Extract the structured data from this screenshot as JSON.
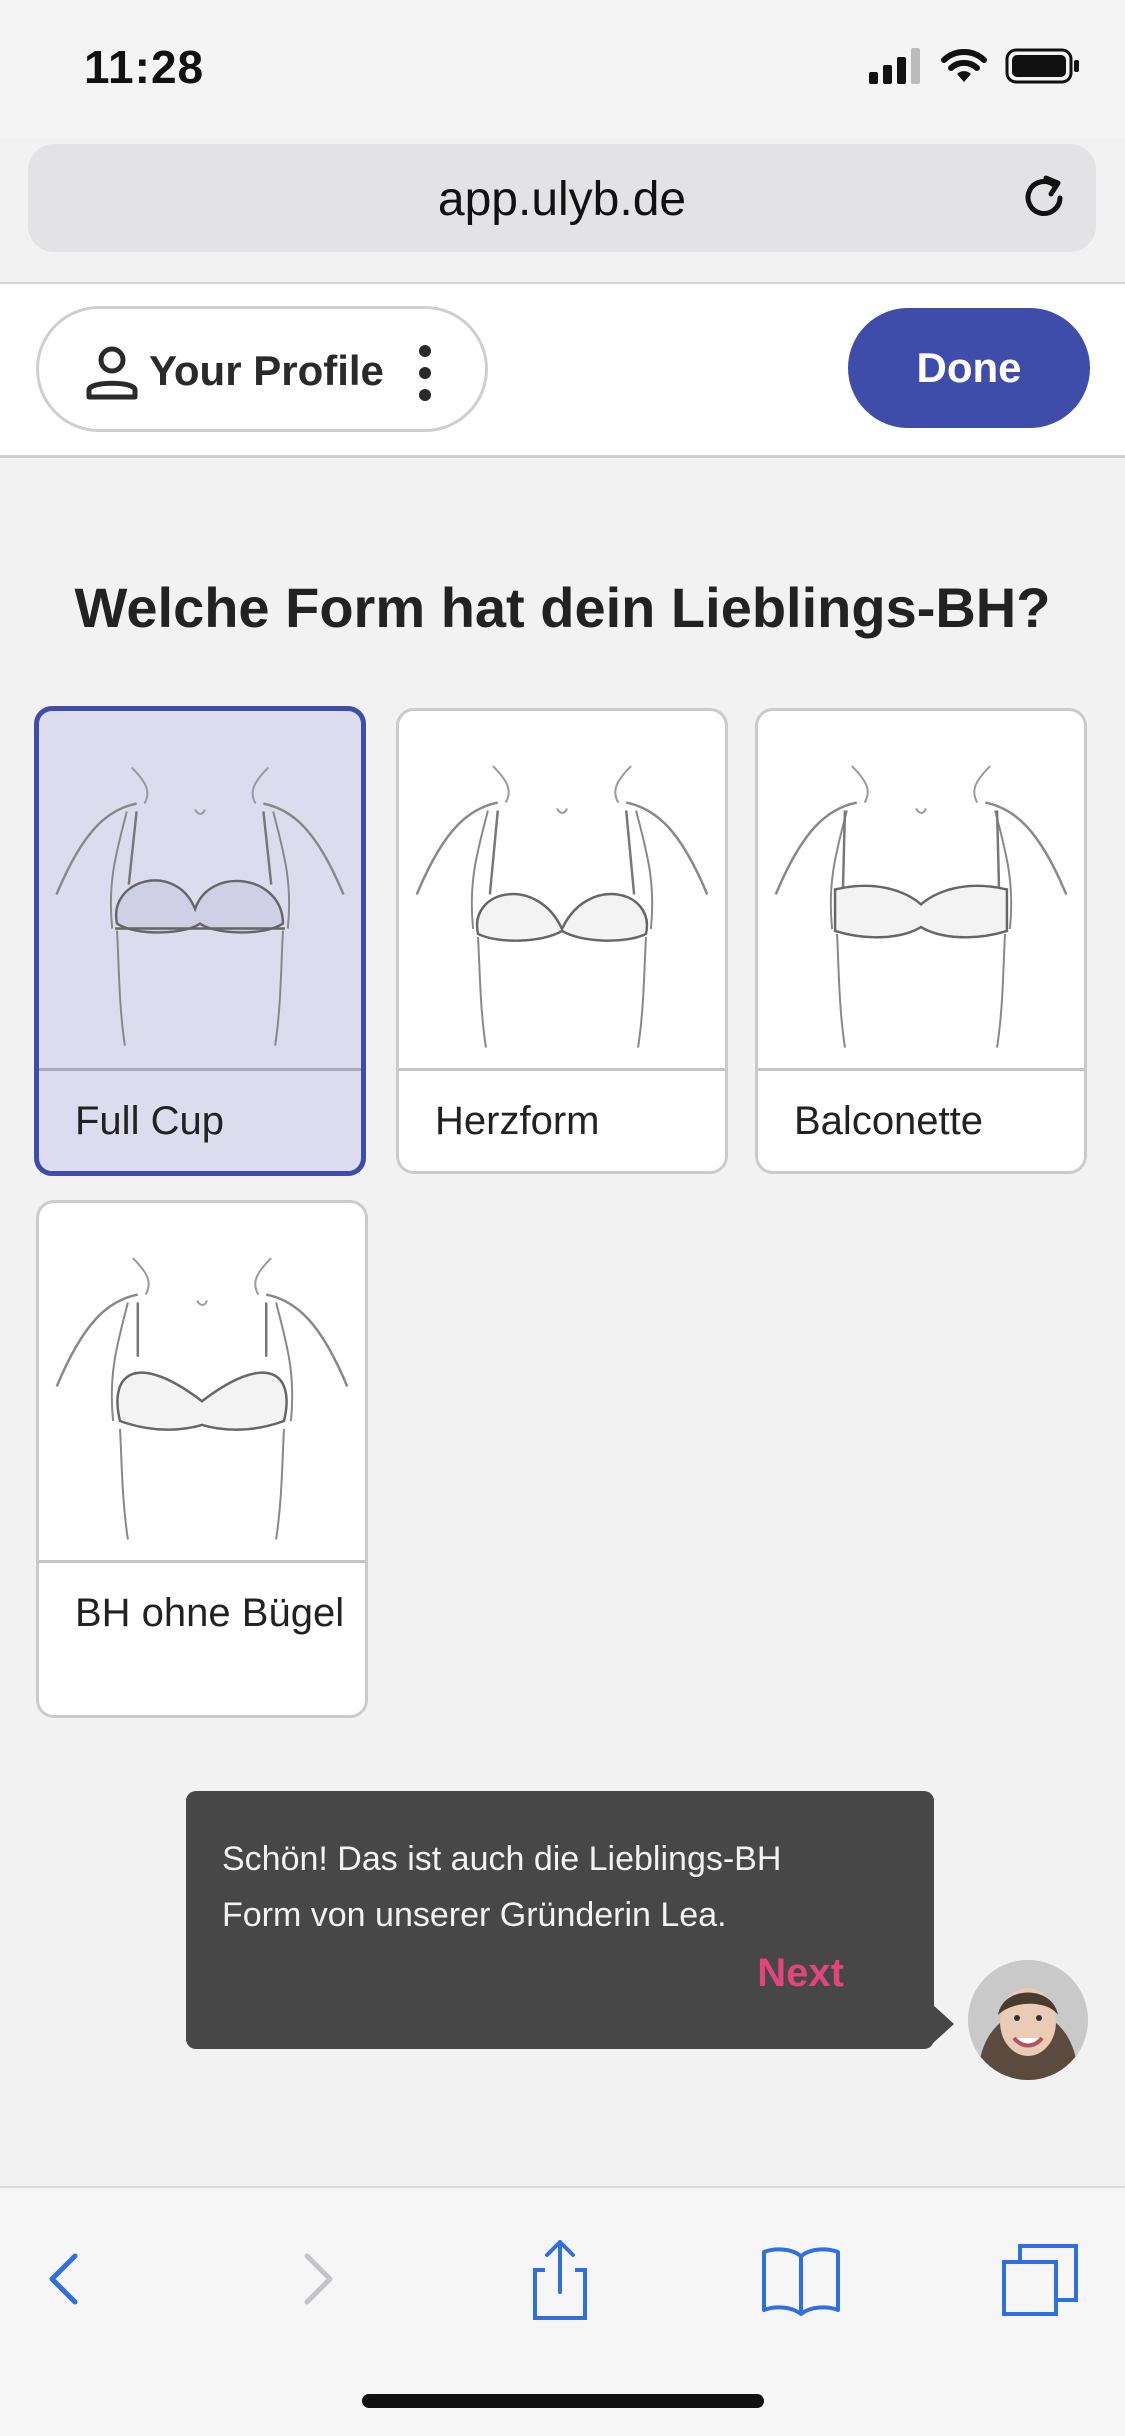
{
  "status_bar": {
    "time": "11:28"
  },
  "browser": {
    "url": "app.ulyb.de"
  },
  "header": {
    "profile_label": "Your Profile",
    "done_label": "Done"
  },
  "question": "Welche Form hat dein Lieblings-BH?",
  "options": [
    {
      "label": "Full Cup",
      "selected": true
    },
    {
      "label": "Herzform",
      "selected": false
    },
    {
      "label": "Balconette",
      "selected": false
    },
    {
      "label": "BH ohne Bügel",
      "selected": false
    }
  ],
  "tooltip": {
    "text": "Schön! Das ist auch die Lieblings-BH Form von unserer Gründerin Lea.",
    "next_label": "Next"
  },
  "colors": {
    "accent": "#3e4caa",
    "next": "#e0457b",
    "tooltip_bg": "#474747"
  }
}
